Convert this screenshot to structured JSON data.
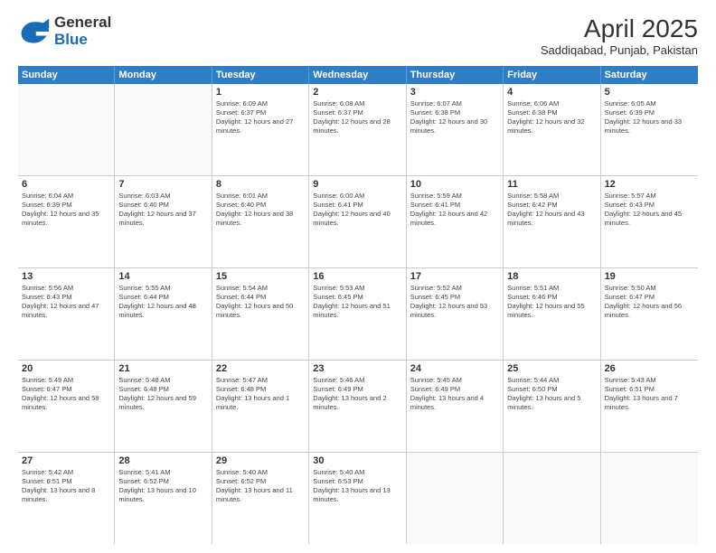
{
  "logo": {
    "line1": "General",
    "line2": "Blue"
  },
  "title": "April 2025",
  "subtitle": "Saddiqabad, Punjab, Pakistan",
  "weekdays": [
    "Sunday",
    "Monday",
    "Tuesday",
    "Wednesday",
    "Thursday",
    "Friday",
    "Saturday"
  ],
  "rows": [
    [
      {
        "day": "",
        "sunrise": "",
        "sunset": "",
        "daylight": ""
      },
      {
        "day": "",
        "sunrise": "",
        "sunset": "",
        "daylight": ""
      },
      {
        "day": "1",
        "sunrise": "Sunrise: 6:09 AM",
        "sunset": "Sunset: 6:37 PM",
        "daylight": "Daylight: 12 hours and 27 minutes."
      },
      {
        "day": "2",
        "sunrise": "Sunrise: 6:08 AM",
        "sunset": "Sunset: 6:37 PM",
        "daylight": "Daylight: 12 hours and 28 minutes."
      },
      {
        "day": "3",
        "sunrise": "Sunrise: 6:07 AM",
        "sunset": "Sunset: 6:38 PM",
        "daylight": "Daylight: 12 hours and 30 minutes."
      },
      {
        "day": "4",
        "sunrise": "Sunrise: 6:06 AM",
        "sunset": "Sunset: 6:38 PM",
        "daylight": "Daylight: 12 hours and 32 minutes."
      },
      {
        "day": "5",
        "sunrise": "Sunrise: 6:05 AM",
        "sunset": "Sunset: 6:39 PM",
        "daylight": "Daylight: 12 hours and 33 minutes."
      }
    ],
    [
      {
        "day": "6",
        "sunrise": "Sunrise: 6:04 AM",
        "sunset": "Sunset: 6:39 PM",
        "daylight": "Daylight: 12 hours and 35 minutes."
      },
      {
        "day": "7",
        "sunrise": "Sunrise: 6:03 AM",
        "sunset": "Sunset: 6:40 PM",
        "daylight": "Daylight: 12 hours and 37 minutes."
      },
      {
        "day": "8",
        "sunrise": "Sunrise: 6:01 AM",
        "sunset": "Sunset: 6:40 PM",
        "daylight": "Daylight: 12 hours and 38 minutes."
      },
      {
        "day": "9",
        "sunrise": "Sunrise: 6:00 AM",
        "sunset": "Sunset: 6:41 PM",
        "daylight": "Daylight: 12 hours and 40 minutes."
      },
      {
        "day": "10",
        "sunrise": "Sunrise: 5:59 AM",
        "sunset": "Sunset: 6:41 PM",
        "daylight": "Daylight: 12 hours and 42 minutes."
      },
      {
        "day": "11",
        "sunrise": "Sunrise: 5:58 AM",
        "sunset": "Sunset: 6:42 PM",
        "daylight": "Daylight: 12 hours and 43 minutes."
      },
      {
        "day": "12",
        "sunrise": "Sunrise: 5:57 AM",
        "sunset": "Sunset: 6:43 PM",
        "daylight": "Daylight: 12 hours and 45 minutes."
      }
    ],
    [
      {
        "day": "13",
        "sunrise": "Sunrise: 5:56 AM",
        "sunset": "Sunset: 6:43 PM",
        "daylight": "Daylight: 12 hours and 47 minutes."
      },
      {
        "day": "14",
        "sunrise": "Sunrise: 5:55 AM",
        "sunset": "Sunset: 6:44 PM",
        "daylight": "Daylight: 12 hours and 48 minutes."
      },
      {
        "day": "15",
        "sunrise": "Sunrise: 5:54 AM",
        "sunset": "Sunset: 6:44 PM",
        "daylight": "Daylight: 12 hours and 50 minutes."
      },
      {
        "day": "16",
        "sunrise": "Sunrise: 5:53 AM",
        "sunset": "Sunset: 6:45 PM",
        "daylight": "Daylight: 12 hours and 51 minutes."
      },
      {
        "day": "17",
        "sunrise": "Sunrise: 5:52 AM",
        "sunset": "Sunset: 6:45 PM",
        "daylight": "Daylight: 12 hours and 53 minutes."
      },
      {
        "day": "18",
        "sunrise": "Sunrise: 5:51 AM",
        "sunset": "Sunset: 6:46 PM",
        "daylight": "Daylight: 12 hours and 55 minutes."
      },
      {
        "day": "19",
        "sunrise": "Sunrise: 5:50 AM",
        "sunset": "Sunset: 6:47 PM",
        "daylight": "Daylight: 12 hours and 56 minutes."
      }
    ],
    [
      {
        "day": "20",
        "sunrise": "Sunrise: 5:49 AM",
        "sunset": "Sunset: 6:47 PM",
        "daylight": "Daylight: 12 hours and 58 minutes."
      },
      {
        "day": "21",
        "sunrise": "Sunrise: 5:48 AM",
        "sunset": "Sunset: 6:48 PM",
        "daylight": "Daylight: 12 hours and 59 minutes."
      },
      {
        "day": "22",
        "sunrise": "Sunrise: 5:47 AM",
        "sunset": "Sunset: 6:48 PM",
        "daylight": "Daylight: 13 hours and 1 minute."
      },
      {
        "day": "23",
        "sunrise": "Sunrise: 5:46 AM",
        "sunset": "Sunset: 6:49 PM",
        "daylight": "Daylight: 13 hours and 2 minutes."
      },
      {
        "day": "24",
        "sunrise": "Sunrise: 5:45 AM",
        "sunset": "Sunset: 6:49 PM",
        "daylight": "Daylight: 13 hours and 4 minutes."
      },
      {
        "day": "25",
        "sunrise": "Sunrise: 5:44 AM",
        "sunset": "Sunset: 6:50 PM",
        "daylight": "Daylight: 13 hours and 5 minutes."
      },
      {
        "day": "26",
        "sunrise": "Sunrise: 5:43 AM",
        "sunset": "Sunset: 6:51 PM",
        "daylight": "Daylight: 13 hours and 7 minutes."
      }
    ],
    [
      {
        "day": "27",
        "sunrise": "Sunrise: 5:42 AM",
        "sunset": "Sunset: 6:51 PM",
        "daylight": "Daylight: 13 hours and 8 minutes."
      },
      {
        "day": "28",
        "sunrise": "Sunrise: 5:41 AM",
        "sunset": "Sunset: 6:52 PM",
        "daylight": "Daylight: 13 hours and 10 minutes."
      },
      {
        "day": "29",
        "sunrise": "Sunrise: 5:40 AM",
        "sunset": "Sunset: 6:52 PM",
        "daylight": "Daylight: 13 hours and 11 minutes."
      },
      {
        "day": "30",
        "sunrise": "Sunrise: 5:40 AM",
        "sunset": "Sunset: 6:53 PM",
        "daylight": "Daylight: 13 hours and 13 minutes."
      },
      {
        "day": "",
        "sunrise": "",
        "sunset": "",
        "daylight": ""
      },
      {
        "day": "",
        "sunrise": "",
        "sunset": "",
        "daylight": ""
      },
      {
        "day": "",
        "sunrise": "",
        "sunset": "",
        "daylight": ""
      }
    ]
  ]
}
